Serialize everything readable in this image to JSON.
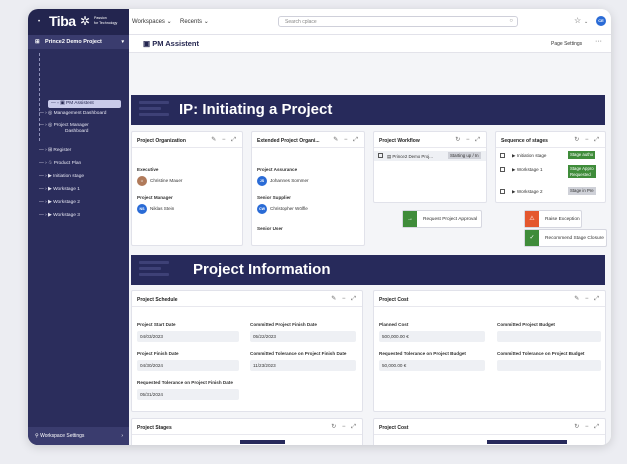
{
  "topbar": {
    "logo_text": "Tiba",
    "logo_sub1": "Passion",
    "logo_sub2": "for Technology",
    "nav_workspaces": "Workspaces",
    "nav_recents": "Recents",
    "search_placeholder": "Search cplace",
    "avatar_initials": "CE"
  },
  "sidebar": {
    "project": "Prince2 Demo Project",
    "items": [
      {
        "label": "PM Assistent"
      },
      {
        "label": "Management Dashboard"
      },
      {
        "label": "Project Manager"
      },
      {
        "label": "Dashboard"
      },
      {
        "label": "Register"
      },
      {
        "label": "Product Plan"
      },
      {
        "label": "Initiation stage"
      },
      {
        "label": "Workstage 1"
      },
      {
        "label": "Workstage 2"
      },
      {
        "label": "Workstage 3"
      }
    ],
    "footer": "Workspace Settings"
  },
  "page": {
    "title": "PM Assistent",
    "settings": "Page Settings",
    "more": "···"
  },
  "banner1": "IP: Initiating a Project",
  "banner2": "Project Information",
  "project_organization": {
    "title": "Project Organization",
    "executive_label": "Executive",
    "executive": "Christine Mauer",
    "pm_label": "Project Manager",
    "pm": "Niklas Stein",
    "pm_initials": "NS"
  },
  "extended_org": {
    "title": "Extended Project Organi...",
    "assurance_label": "Project Assurance",
    "assurance": "Johannes Sommer",
    "assurance_initials": "JS",
    "supplier_label": "Senior Supplier",
    "supplier": "Christopher Wölfle",
    "supplier_initials": "CW",
    "user_label": "Senior User"
  },
  "workflow": {
    "title": "Project Workflow",
    "row_name": "Prince2 Demo Proj...",
    "row_status": "Starting up / In",
    "btn_approval": "Request Project Approval"
  },
  "sequence": {
    "title": "Sequence of stages",
    "rows": [
      {
        "name": "Initiation stage",
        "tag": "Stage autho"
      },
      {
        "name": "Workstage 1",
        "tag": "Stage Appro"
      },
      {
        "name": "",
        "tag": "Requested"
      },
      {
        "name": "Workstage 2",
        "tag": "Stage in Pre"
      }
    ],
    "btn_exception": "Raise Exception",
    "btn_closure": "Recommend Stage Closure"
  },
  "schedule": {
    "title": "Project Schedule",
    "start_label": "Project Start Date",
    "start": "04/03/2023",
    "committed_finish_label": "Committed Project Finish Date",
    "committed_finish": "05/22/2023",
    "finish_label": "Project Finish Date",
    "finish": "04/30/2024",
    "committed_tol_label": "Committed Tolerance on Project Finish Date",
    "committed_tol": "11/23/2023",
    "req_tol_label": "Requested Tolerance on Project Finish Date",
    "req_tol": "05/31/2024"
  },
  "cost": {
    "title": "Project Cost",
    "planned_label": "Planned Cost",
    "planned": "500,000.00 €",
    "committed_budget_label": "Committed Project Budget",
    "req_tol_label": "Requested Tolerance on Project Budget",
    "req_tol": "50,000.00 €",
    "committed_tol_label": "Committed Tolerance on Project Budget"
  },
  "stages_card": {
    "title": "Project Stages"
  },
  "cost_card2": {
    "title": "Project Cost"
  },
  "colors": {
    "navy": "#23254f",
    "sidebar": "#2b2d5c",
    "green": "#3f8c3a",
    "orange": "#e4572e",
    "blue": "#2a6bd6"
  }
}
